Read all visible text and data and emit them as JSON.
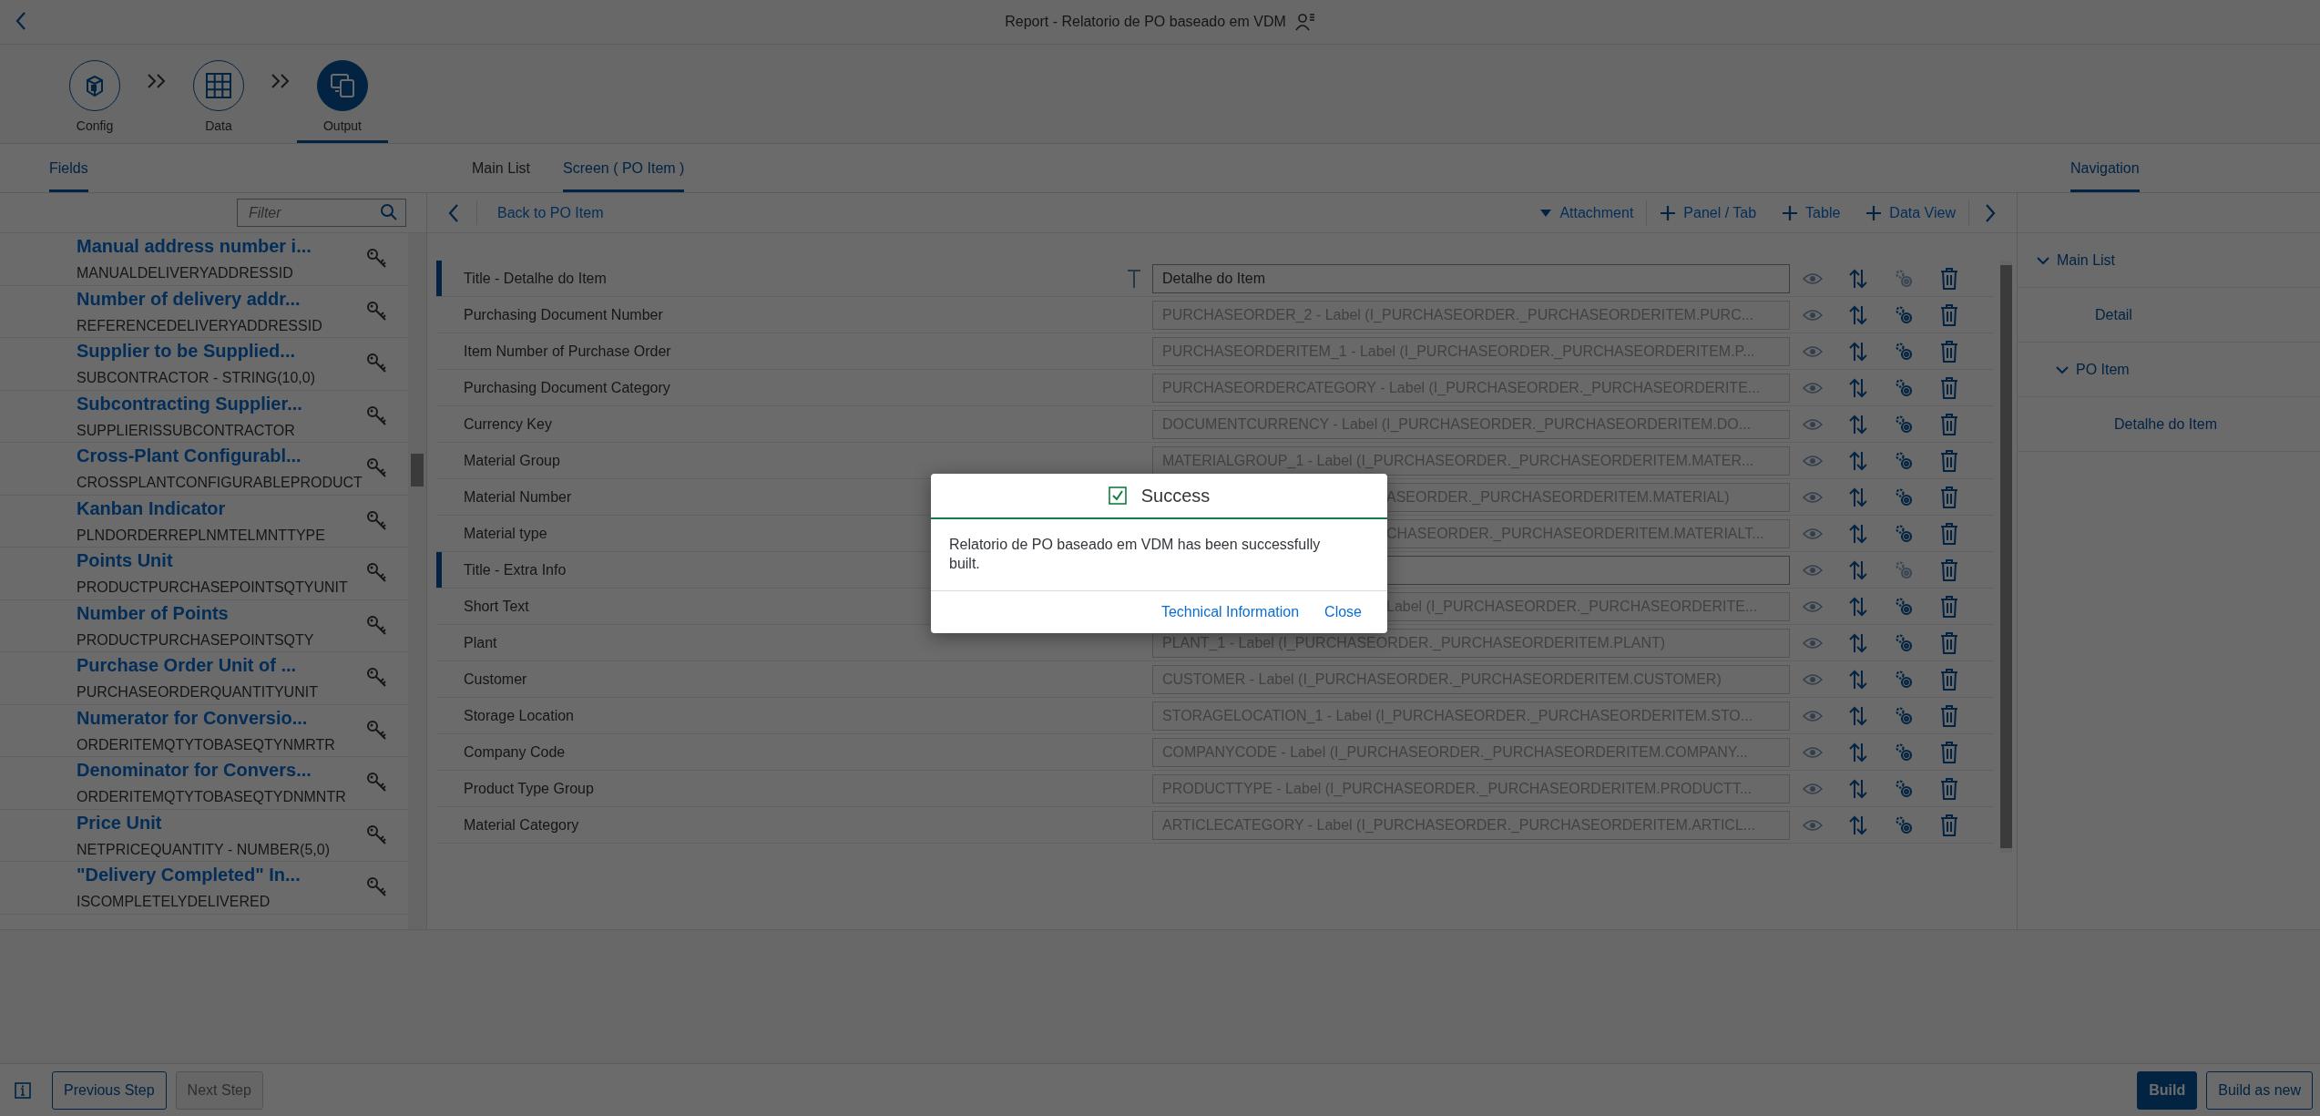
{
  "header": {
    "title": "Report - Relatorio de PO baseado em VDM"
  },
  "wizard": [
    {
      "kind": "config",
      "label": "Config",
      "selected": false
    },
    {
      "kind": "data",
      "label": "Data",
      "selected": false
    },
    {
      "kind": "output",
      "label": "Output",
      "selected": true
    }
  ],
  "left_tabs": [
    {
      "label": "Fields",
      "selected": true
    }
  ],
  "center_tabs": [
    {
      "label": "Main List",
      "selected": false
    },
    {
      "label": "Screen ( PO Item )",
      "selected": true
    }
  ],
  "right_tabs": [
    {
      "label": "Navigation",
      "selected": true
    }
  ],
  "filter": {
    "placeholder": "Filter"
  },
  "fields": [
    {
      "title": "Manual address number i...",
      "name": "MANUALDELIVERYADDRESSID"
    },
    {
      "title": "Number of delivery addr...",
      "name": "REFERENCEDELIVERYADDRESSID"
    },
    {
      "title": "Supplier to be Supplied...",
      "name": "SUBCONTRACTOR - STRING(10,0)"
    },
    {
      "title": "Subcontracting Supplier...",
      "name": "SUPPLIERISSUBCONTRACTOR"
    },
    {
      "title": "Cross-Plant Configurabl...",
      "name": "CROSSPLANTCONFIGURABLEPRODUCT"
    },
    {
      "title": "Kanban Indicator",
      "name": "PLNDORDERREPLNMTELMNTTYPE"
    },
    {
      "title": "Points Unit",
      "name": "PRODUCTPURCHASEPOINTSQTYUNIT"
    },
    {
      "title": "Number of Points",
      "name": "PRODUCTPURCHASEPOINTSQTY"
    },
    {
      "title": "Purchase Order Unit of ...",
      "name": "PURCHASEORDERQUANTITYUNIT"
    },
    {
      "title": "Numerator for Conversio...",
      "name": "ORDERITEMQTYTOBASEQTYNMRTR"
    },
    {
      "title": "Denominator for Convers...",
      "name": "ORDERITEMQTYTOBASEQTYDNMNTR"
    },
    {
      "title": "Price Unit",
      "name": "NETPRICEQUANTITY - NUMBER(5,0)"
    },
    {
      "title": "\"Delivery Completed\" In...",
      "name": "ISCOMPLETELYDELIVERED"
    }
  ],
  "toolbar": {
    "back": "Back to PO Item",
    "actions": [
      {
        "kind": "menu",
        "label": "Attachment"
      },
      {
        "kind": "add",
        "label": "Panel / Tab"
      },
      {
        "kind": "add",
        "label": "Table"
      },
      {
        "kind": "add",
        "label": "Data View"
      }
    ]
  },
  "rows": [
    {
      "kind": "title",
      "label": "Title - Detalhe do Item",
      "value": "Detalhe do Item",
      "settings_disabled": true,
      "covered": false
    },
    {
      "kind": "field",
      "label": "Purchasing Document Number",
      "value": "PURCHASEORDER_2 - Label (I_PURCHASEORDER._PURCHASEORDERITEM.PURC...",
      "settings_disabled": false,
      "covered": false
    },
    {
      "kind": "field",
      "label": "Item Number of Purchase Order",
      "value": "PURCHASEORDERITEM_1 - Label (I_PURCHASEORDER._PURCHASEORDERITEM.P...",
      "settings_disabled": false,
      "covered": false
    },
    {
      "kind": "field",
      "label": "Purchasing Document Category",
      "value": "PURCHASEORDERCATEGORY - Label (I_PURCHASEORDER._PURCHASEORDERITE...",
      "settings_disabled": false,
      "covered": false
    },
    {
      "kind": "field",
      "label": "Currency Key",
      "value": "DOCUMENTCURRENCY - Label (I_PURCHASEORDER._PURCHASEORDERITEM.DO...",
      "settings_disabled": false,
      "covered": false
    },
    {
      "kind": "field",
      "label": "Material Group",
      "value": "MATERIALGROUP_1 - Label (I_PURCHASEORDER._PURCHASEORDERITEM.MATER...",
      "settings_disabled": false,
      "covered": false
    },
    {
      "kind": "field",
      "label": "Material Number",
      "value": "ASEORDER._PURCHASEORDERITEM.MATERIAL)",
      "settings_disabled": false,
      "covered": true
    },
    {
      "kind": "field",
      "label": "Material type",
      "value": "CHASEORDER._PURCHASEORDERITEM.MATERIALT...",
      "settings_disabled": false,
      "covered": true
    },
    {
      "kind": "title",
      "label": "Title - Extra Info",
      "settings_disabled": true,
      "covered": true
    },
    {
      "kind": "field",
      "label": "Short Text",
      "value": "Label (I_PURCHASEORDER._PURCHASEORDERITE...",
      "settings_disabled": false,
      "covered": true
    },
    {
      "kind": "field",
      "label": "Plant",
      "value": "PLANT_1 - Label (I_PURCHASEORDER._PURCHASEORDERITEM.PLANT)",
      "settings_disabled": false,
      "covered": false
    },
    {
      "kind": "field",
      "label": "Customer",
      "value": "CUSTOMER - Label (I_PURCHASEORDER._PURCHASEORDERITEM.CUSTOMER)",
      "settings_disabled": false,
      "covered": false
    },
    {
      "kind": "field",
      "label": "Storage Location",
      "value": "STORAGELOCATION_1 - Label (I_PURCHASEORDER._PURCHASEORDERITEM.STO...",
      "settings_disabled": false,
      "covered": false
    },
    {
      "kind": "field",
      "label": "Company Code",
      "value": "COMPANYCODE - Label (I_PURCHASEORDER._PURCHASEORDERITEM.COMPANY...",
      "settings_disabled": false,
      "covered": false
    },
    {
      "kind": "field",
      "label": "Product Type Group",
      "value": "PRODUCTTYPE - Label (I_PURCHASEORDER._PURCHASEORDERITEM.PRODUCTT...",
      "settings_disabled": false,
      "covered": false
    },
    {
      "kind": "field",
      "label": "Material Category",
      "value": "ARTICLECATEGORY - Label (I_PURCHASEORDER._PURCHASEORDERITEM.ARTICL...",
      "settings_disabled": false,
      "covered": false
    }
  ],
  "navigation": [
    {
      "label": "Main List",
      "expanded": true,
      "children": [
        {
          "label": "Detail"
        },
        {
          "label": "PO Item",
          "expanded": true,
          "children": [
            {
              "label": "Detalhe do Item"
            }
          ]
        }
      ]
    }
  ],
  "dialog": {
    "title": "Success",
    "message": "Relatorio de PO baseado em VDM has been successfully built.",
    "buttons": [
      "Technical Information",
      "Close"
    ]
  },
  "footer": {
    "left": [
      {
        "label": "Previous Step",
        "disabled": false
      },
      {
        "label": "Next Step",
        "disabled": true
      }
    ],
    "right": [
      {
        "label": "Build",
        "emphasized": true
      },
      {
        "label": "Build as new",
        "emphasized": false
      }
    ]
  }
}
